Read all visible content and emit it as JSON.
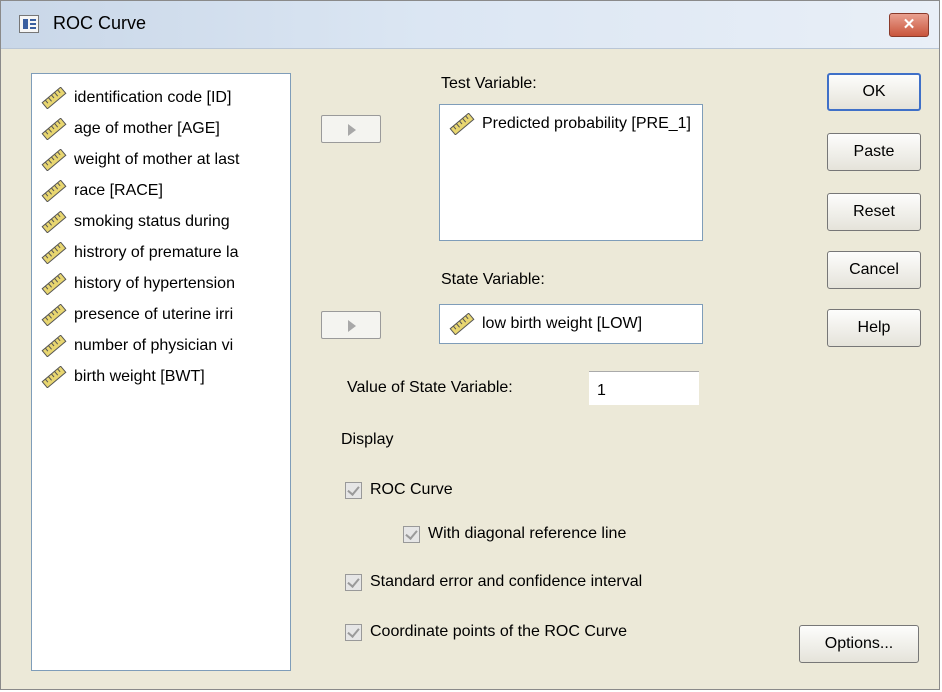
{
  "window": {
    "title": "ROC Curve",
    "close_label": "✕"
  },
  "variables": [
    {
      "label": "identification code [ID]",
      "icon": "scale-ruler-icon"
    },
    {
      "label": "age of mother [AGE]",
      "icon": "scale-ruler-icon"
    },
    {
      "label": "weight of mother at last",
      "icon": "scale-ruler-icon"
    },
    {
      "label": "race [RACE]",
      "icon": "scale-ruler-icon"
    },
    {
      "label": "smoking status during",
      "icon": "scale-ruler-icon"
    },
    {
      "label": "histrory of premature la",
      "icon": "scale-ruler-icon"
    },
    {
      "label": "history of hypertension",
      "icon": "scale-ruler-icon"
    },
    {
      "label": "presence of uterine irri",
      "icon": "scale-ruler-icon"
    },
    {
      "label": "number of physician vi",
      "icon": "scale-ruler-icon"
    },
    {
      "label": "birth weight [BWT]",
      "icon": "scale-ruler-icon"
    }
  ],
  "test_variable": {
    "label": "Test Variable:",
    "items": [
      {
        "label": "Predicted probability [PRE_1]",
        "icon": "scale-ruler-icon"
      }
    ]
  },
  "state_variable": {
    "label": "State Variable:",
    "value": "low birth weight [LOW]",
    "icon": "scale-ruler-icon"
  },
  "value_of_state": {
    "label": "Value of State Variable:",
    "value": "1"
  },
  "display": {
    "label": "Display",
    "roc_curve": {
      "label": "ROC Curve",
      "checked": true
    },
    "diagonal": {
      "label": "With diagonal reference line",
      "checked": true
    },
    "std_error": {
      "label": "Standard error and confidence interval",
      "checked": true
    },
    "coord_points": {
      "label": "Coordinate points of the ROC Curve",
      "checked": true
    }
  },
  "buttons": {
    "ok": "OK",
    "paste": "Paste",
    "reset": "Reset",
    "cancel": "Cancel",
    "help": "Help",
    "options": "Options..."
  },
  "colors": {
    "title_bar": "#dbe6f3",
    "dialog_bg": "#ece9d8",
    "default_button_border": "#3f70c8"
  }
}
